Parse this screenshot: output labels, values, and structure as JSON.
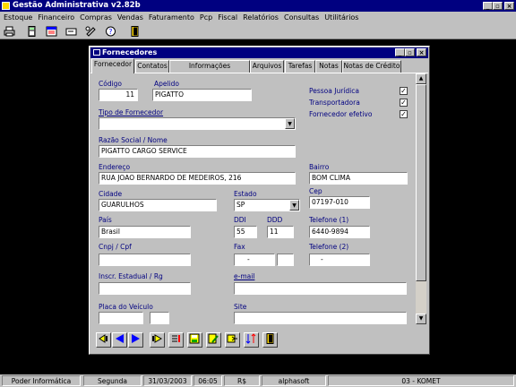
{
  "app": {
    "title": "Gestão Administrativa v2.82b",
    "window_controls": {
      "min": "_",
      "max": "▫",
      "close": "×"
    }
  },
  "menu": [
    "Estoque",
    "Financeiro",
    "Compras",
    "Vendas",
    "Faturamento",
    "Pcp",
    "Fiscal",
    "Relatórios",
    "Consultas",
    "Utilitários"
  ],
  "toolbar_icons": [
    "printer-icon",
    "calculator-icon",
    "calendar-icon",
    "card-icon",
    "satellite-icon",
    "help-icon",
    "exit-door-icon"
  ],
  "child": {
    "title": "Fornecedores",
    "controls": {
      "min": "_",
      "max": "▫",
      "close": "×"
    },
    "tabs": [
      "Fornecedor",
      "Contatos",
      "Informações Financeiras",
      "Arquivos",
      "Tarefas",
      "Notas",
      "Notas de Crédito"
    ],
    "active_tab": "Fornecedor"
  },
  "form": {
    "codigo": {
      "label": "Código",
      "value": "11"
    },
    "apelido": {
      "label": "Apelido",
      "value": "PIGATTO"
    },
    "pessoa_juridica": {
      "label": "Pessoa Jurídica",
      "checked": "✓"
    },
    "transportadora": {
      "label": "Transportadora",
      "checked": "✓"
    },
    "fornecedor_efetivo": {
      "label": "Fornecedor efetivo",
      "checked": "✓"
    },
    "tipo": {
      "label": "Tipo de Fornecedor",
      "value": ""
    },
    "razao": {
      "label": "Razão Social / Nome",
      "value": "PIGATTO CARGO SERVICE"
    },
    "endereco": {
      "label": "Endereço",
      "value": "RUA JOAO BERNARDO DE MEDEIROS, 216"
    },
    "bairro": {
      "label": "Bairro",
      "value": "BOM CLIMA"
    },
    "cidade": {
      "label": "Cidade",
      "value": "GUARULHOS"
    },
    "estado": {
      "label": "Estado",
      "value": "SP"
    },
    "cep": {
      "label": "Cep",
      "value": "07197-010"
    },
    "pais": {
      "label": "País",
      "value": "Brasil"
    },
    "ddi": {
      "label": "DDI",
      "value": "55"
    },
    "ddd": {
      "label": "DDD",
      "value": "11"
    },
    "telefone1": {
      "label": "Telefone (1)",
      "value": "6440-9894"
    },
    "cnpj": {
      "label": "Cnpj / Cpf",
      "value": ""
    },
    "fax": {
      "label": "Fax",
      "value": "-"
    },
    "telefone2": {
      "label": "Telefone (2)",
      "value": "-"
    },
    "inscr": {
      "label": "Inscr. Estadual / Rg",
      "value": ""
    },
    "email": {
      "label": "e-mail",
      "value": ""
    },
    "placa": {
      "label": "Placa do Veículo",
      "value": ""
    },
    "site": {
      "label": "Site",
      "value": ""
    }
  },
  "nav_buttons": [
    "first-icon",
    "prev-icon",
    "next-icon",
    "last-icon",
    "new-icon",
    "save-icon",
    "edit-icon",
    "search-icon",
    "sort-icon",
    "exit-icon"
  ],
  "status": [
    "Poder Informática",
    "Segunda",
    "31/03/2003",
    "06:05",
    "R$",
    "alphasoft",
    "03 - KOMET"
  ],
  "colors": {
    "title_bar": "#000080",
    "face": "#c0c0c0",
    "desktop": "#000000",
    "label_text": "#000080"
  }
}
